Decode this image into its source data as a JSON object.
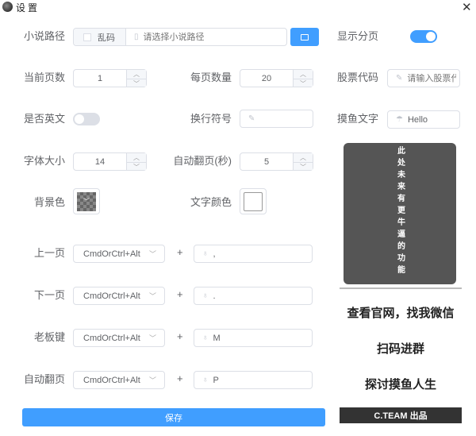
{
  "window": {
    "title": "设置",
    "close_icon": "close-icon"
  },
  "novel_path": {
    "label": "小说路径",
    "garble_label": "乱码",
    "garble_checked": false,
    "placeholder": "请选择小说路径",
    "value": ""
  },
  "show_page": {
    "label": "显示分页",
    "on": true
  },
  "current_page": {
    "label": "当前页数",
    "value": "1"
  },
  "page_size": {
    "label": "每页数量",
    "value": "20"
  },
  "stock_code": {
    "label": "股票代码",
    "placeholder": "请输入股票代码",
    "value": ""
  },
  "english": {
    "label": "是否英文",
    "on": false
  },
  "line_break": {
    "label": "换行符号",
    "value": ""
  },
  "fish_text": {
    "label": "摸鱼文字",
    "value": "Hello"
  },
  "font_size": {
    "label": "字体大小",
    "value": "14"
  },
  "auto_page_sec": {
    "label": "自动翻页(秒)",
    "value": "5"
  },
  "bg_color": {
    "label": "背景色",
    "value": "transparent"
  },
  "text_color": {
    "label": "文字颜色",
    "value": "#ffffff"
  },
  "hotkeys": [
    {
      "label": "上一页",
      "modifier": "CmdOrCtrl+Alt",
      "key": ","
    },
    {
      "label": "下一页",
      "modifier": "CmdOrCtrl+Alt",
      "key": "."
    },
    {
      "label": "老板键",
      "modifier": "CmdOrCtrl+Alt",
      "key": "M"
    },
    {
      "label": "自动翻页",
      "modifier": "CmdOrCtrl+Alt",
      "key": "P"
    }
  ],
  "plus": "+",
  "save_label": "保存",
  "preview": {
    "text": "此处未来有更牛逼的功能"
  },
  "side": {
    "line1": "查看官网，找我微信",
    "line2": "扫码进群",
    "line3": "探讨摸鱼人生",
    "footer": "C.TEAM 出品"
  },
  "colors": {
    "primary": "#409eff",
    "preview_bg": "#555555",
    "footer_bg": "#333333"
  }
}
